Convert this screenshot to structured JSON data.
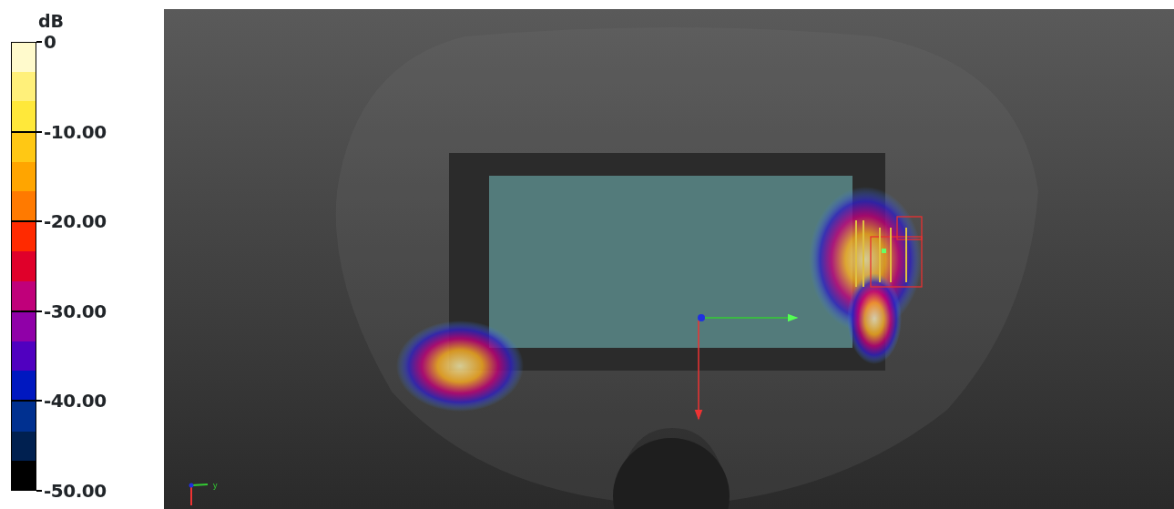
{
  "legend": {
    "unit": "dB",
    "ticks": [
      "0",
      "-10.00",
      "-20.00",
      "-30.00",
      "-40.00",
      "-50.00"
    ],
    "bands": [
      {
        "color": "#fffacc"
      },
      {
        "color": "#fff07a"
      },
      {
        "color": "#ffe83a"
      },
      {
        "color": "#ffc814"
      },
      {
        "color": "#ffa500"
      },
      {
        "color": "#ff7a00"
      },
      {
        "color": "#ff2a00"
      },
      {
        "color": "#e0002a"
      },
      {
        "color": "#c0007a"
      },
      {
        "color": "#9000a8"
      },
      {
        "color": "#5000c0"
      },
      {
        "color": "#0018c0"
      },
      {
        "color": "#003090"
      },
      {
        "color": "#002050"
      },
      {
        "color": "#000000"
      }
    ]
  },
  "viewport": {
    "orientation_axis_label": "y"
  }
}
